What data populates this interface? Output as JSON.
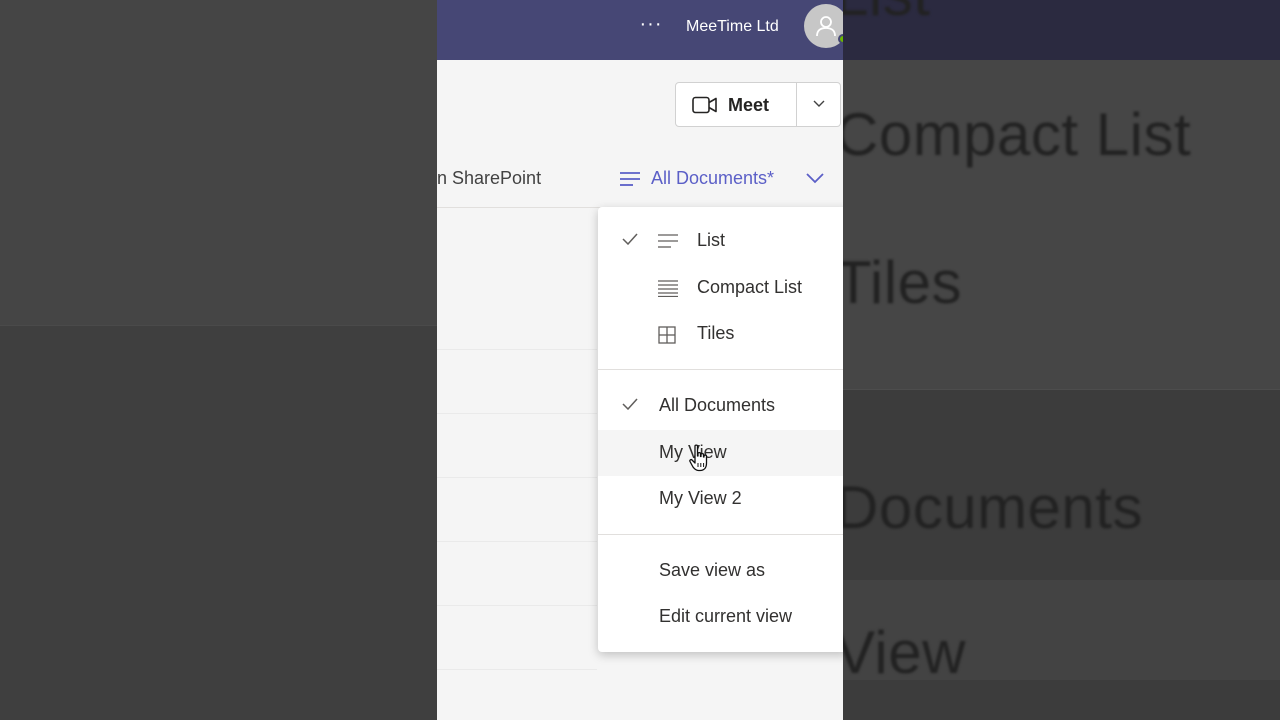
{
  "background": {
    "echo_lines": [
      "List",
      "Compact List",
      "Tiles",
      "Documents",
      "View"
    ]
  },
  "topbar": {
    "more_label": "···",
    "org_name": "MeeTime Ltd",
    "avatar_icon": "person-icon"
  },
  "meet": {
    "label": "Meet",
    "icon": "video-camera-icon",
    "dropdown_icon": "chevron-down-icon"
  },
  "toolbar": {
    "sharepoint_link": "n SharePoint",
    "view_switcher_label": "All Documents*"
  },
  "menu": {
    "layouts": [
      {
        "label": "List",
        "checked": true,
        "icon": "list-icon"
      },
      {
        "label": "Compact List",
        "checked": false,
        "icon": "compact-list-icon"
      },
      {
        "label": "Tiles",
        "checked": false,
        "icon": "tiles-icon"
      }
    ],
    "views": [
      {
        "label": "All Documents",
        "checked": true
      },
      {
        "label": "My View",
        "checked": false,
        "hovered": true
      },
      {
        "label": "My View 2",
        "checked": false
      }
    ],
    "actions": [
      {
        "label": "Save view as"
      },
      {
        "label": "Edit current view"
      }
    ]
  },
  "colors": {
    "header": "#464775",
    "accent": "#5b5fc7",
    "presence": "#6bb700"
  }
}
